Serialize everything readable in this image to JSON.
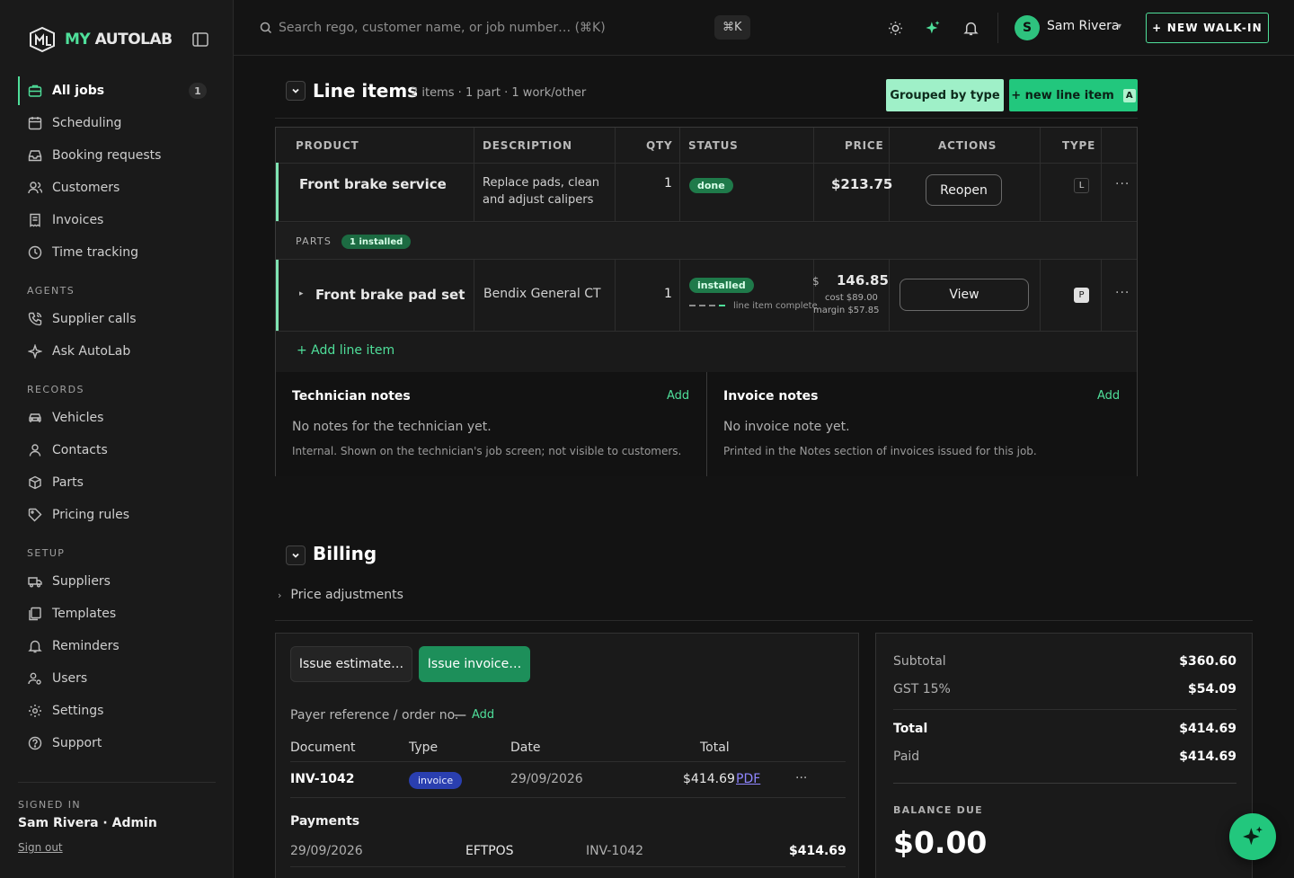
{
  "brand": {
    "my": "MY",
    "rest": "AUTOLAB"
  },
  "nav": {
    "items_main": [
      {
        "label": "All jobs",
        "icon": "briefcase-icon",
        "badge": "1",
        "active": true
      },
      {
        "label": "Scheduling",
        "icon": "calendar-icon"
      },
      {
        "label": "Booking requests",
        "icon": "inbox-icon"
      },
      {
        "label": "Customers",
        "icon": "users-icon"
      },
      {
        "label": "Invoices",
        "icon": "receipt-icon"
      },
      {
        "label": "Time tracking",
        "icon": "clock-icon"
      }
    ],
    "agents_label": "AGENTS",
    "items_agents": [
      {
        "label": "Supplier calls",
        "icon": "phone-icon"
      },
      {
        "label": "Ask AutoLab",
        "icon": "sparkle-icon"
      }
    ],
    "records_label": "RECORDS",
    "items_records": [
      {
        "label": "Vehicles",
        "icon": "car-icon"
      },
      {
        "label": "Contacts",
        "icon": "user-icon"
      },
      {
        "label": "Parts",
        "icon": "box-icon"
      },
      {
        "label": "Pricing rules",
        "icon": "tag-icon"
      }
    ],
    "setup_label": "SETUP",
    "items_setup": [
      {
        "label": "Suppliers",
        "icon": "truck-icon"
      },
      {
        "label": "Templates",
        "icon": "template-icon"
      },
      {
        "label": "Reminders",
        "icon": "bell-icon"
      },
      {
        "label": "Users",
        "icon": "users-gear-icon"
      },
      {
        "label": "Settings",
        "icon": "gear-icon"
      },
      {
        "label": "Support",
        "icon": "help-icon"
      }
    ]
  },
  "signed_in": {
    "label": "SIGNED IN",
    "name": "Sam Rivera · Admin",
    "signout": "Sign out"
  },
  "topbar": {
    "search_placeholder": "Search rego, customer name, or job number… (⌘K)",
    "kbd": "⌘K",
    "user_initial": "S",
    "user_name": "Sam Rivera",
    "new_walkin": "+ NEW WALK-IN"
  },
  "line_items": {
    "title": "Line items",
    "subtitle": "2 items · 1 part · 1 work/other",
    "grouped_btn": "Grouped by type",
    "new_line_btn": "+ new line item",
    "new_line_kbd": "A",
    "columns": [
      "PRODUCT",
      "DESCRIPTION",
      "QTY",
      "STATUS",
      "PRICE",
      "ACTIONS",
      "TYPE"
    ],
    "row1": {
      "product": "Front brake service",
      "description": "Replace pads, clean and adjust calipers",
      "qty": "1",
      "status": "done",
      "price": "$213.75",
      "action": "Reopen",
      "type": "L",
      "more": "···"
    },
    "parts_label": "PARTS",
    "parts_badge": "1 installed",
    "row2": {
      "caret": "▸",
      "product": "Front brake pad set",
      "description": "Bendix General CT",
      "qty": "1",
      "status": "installed",
      "progress_text": "line item complete",
      "progress_steps": [
        false,
        false,
        false,
        true
      ],
      "price_currency": "$",
      "price": "146.85",
      "cost": "cost $89.00",
      "margin": "margin $57.85",
      "action": "View",
      "type": "P",
      "more": "···"
    },
    "add_line": "+ Add line item"
  },
  "notes": {
    "tech": {
      "title": "Technician notes",
      "add": "Add",
      "empty": "No notes for the technician yet.",
      "help": "Internal. Shown on the technician's job screen; not visible to customers."
    },
    "invoice": {
      "title": "Invoice notes",
      "add": "Add",
      "empty": "No invoice note yet.",
      "help": "Printed in the Notes section of invoices issued for this job."
    }
  },
  "billing": {
    "title": "Billing",
    "price_adjustments": "Price adjustments",
    "issue_estimate": "Issue estimate…",
    "issue_invoice": "Issue invoice…",
    "payer_label": "Payer reference / order no.",
    "payer_value": "—",
    "payer_add": "Add",
    "doc_headers": {
      "document": "Document",
      "type": "Type",
      "date": "Date",
      "total": "Total"
    },
    "doc_row": {
      "document": "INV-1042",
      "type": "invoice",
      "date": "29/09/2026",
      "total": "$414.69",
      "pdf": "PDF",
      "more": "···"
    },
    "payments_label": "Payments",
    "payment_row": {
      "date": "29/09/2026",
      "method": "EFTPOS",
      "ref": "INV-1042",
      "amount": "$414.69"
    },
    "summary": {
      "subtotal_label": "Subtotal",
      "subtotal": "$360.60",
      "gst_label": "GST 15%",
      "gst": "$54.09",
      "total_label": "Total",
      "total": "$414.69",
      "paid_label": "Paid",
      "paid": "$414.69",
      "balance_label": "BALANCE DUE",
      "balance": "$0.00"
    }
  },
  "colors": {
    "accent": "#4fdf9a",
    "accent_dark": "#1d8f5a",
    "bg": "#131313",
    "panel": "#1a1a1a",
    "invoice_badge": "#2a3fb0"
  }
}
